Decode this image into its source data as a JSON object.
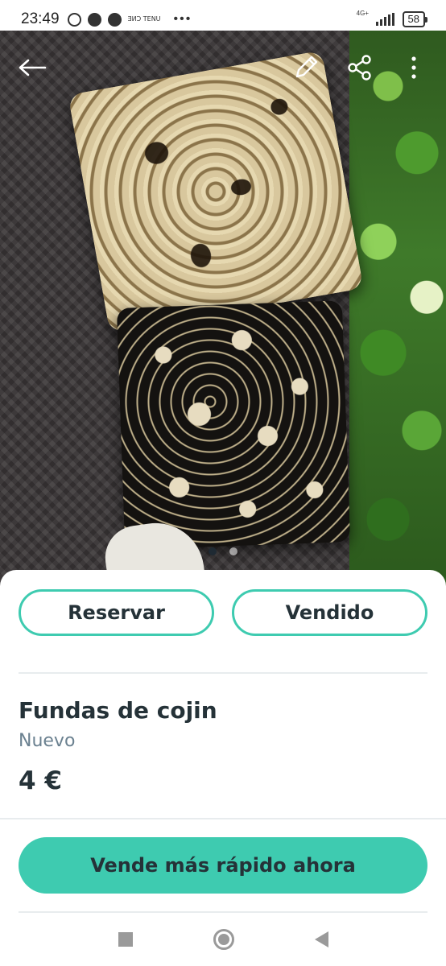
{
  "status_bar": {
    "time": "23:49",
    "network_label": "4G+",
    "battery": "58",
    "app_text": "ƎИƆ ΤΕΝU"
  },
  "photo": {
    "page_count": 2,
    "active_page": 1
  },
  "actions": {
    "reserve_label": "Reservar",
    "sold_label": "Vendido"
  },
  "product": {
    "title": "Fundas de cojin",
    "condition": "Nuevo",
    "price": "4 €"
  },
  "cta": {
    "label": "Vende más rápido ahora"
  },
  "colors": {
    "accent": "#3ecbb0",
    "text_primary": "#253238",
    "text_secondary": "#6b8190"
  },
  "icons": {
    "back": "back-arrow-icon",
    "edit": "pencil-icon",
    "share": "share-icon",
    "more": "more-vertical-icon"
  }
}
